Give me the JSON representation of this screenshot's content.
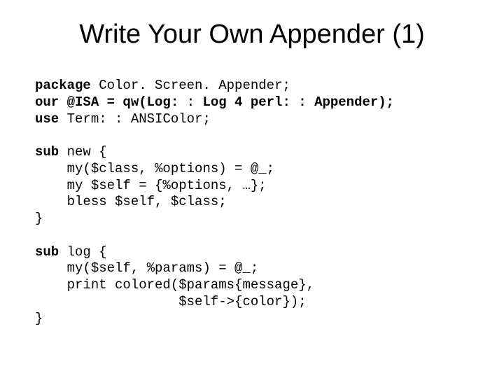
{
  "title": "Write Your Own Appender (1)",
  "code": {
    "l1a": "package",
    "l1b": " Color. Screen. Appender;",
    "l2a": "our @ISA = qw(Log: : Log 4 perl: : Appender);",
    "l3a": "use",
    "l3b": " Term: : ANSIColor;",
    "l4a": "sub",
    "l4b": " new {",
    "l5": "    my($class, %options) = @_;",
    "l6": "    my $self = {%options, …};",
    "l7": "    bless $self, $class;",
    "l8": "}",
    "l9a": "sub",
    "l9b": " log {",
    "l10": "    my($self, %params) = @_;",
    "l11": "    print colored($params{message},",
    "l12": "                  $self->{color});",
    "l13": "}"
  }
}
